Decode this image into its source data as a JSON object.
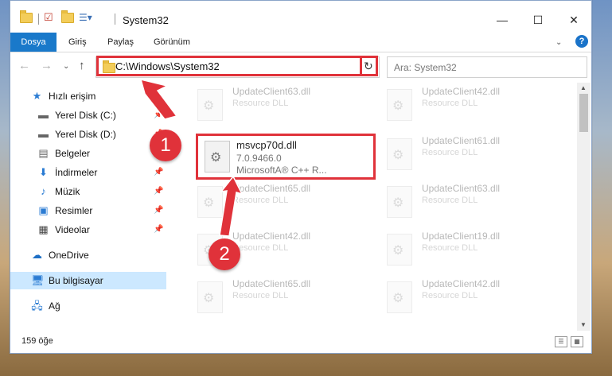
{
  "window": {
    "title": "System32",
    "minimize": "—",
    "maximize": "☐",
    "close": "✕"
  },
  "ribbon": {
    "tabs": [
      "Dosya",
      "Giriş",
      "Paylaş",
      "Görünüm"
    ],
    "help": "?"
  },
  "address": {
    "path": "C:\\Windows\\System32",
    "search_placeholder": "Ara: System32"
  },
  "sidebar": {
    "items": [
      {
        "label": "Hızlı erişim",
        "icon": "star-icon"
      },
      {
        "label": "Yerel Disk (C:)",
        "icon": "drive-icon"
      },
      {
        "label": "Yerel Disk (D:)",
        "icon": "drive-icon"
      },
      {
        "label": "Belgeler",
        "icon": "documents-icon"
      },
      {
        "label": "İndirmeler",
        "icon": "download-icon"
      },
      {
        "label": "Müzik",
        "icon": "music-icon"
      },
      {
        "label": "Resimler",
        "icon": "pictures-icon"
      },
      {
        "label": "Videolar",
        "icon": "video-icon"
      },
      {
        "label": "OneDrive",
        "icon": "cloud-icon"
      },
      {
        "label": "Bu bilgisayar",
        "icon": "computer-icon"
      },
      {
        "label": "Ağ",
        "icon": "network-icon"
      }
    ]
  },
  "files": {
    "col1": [
      {
        "name": "UpdateClient63.dll",
        "desc": "Resource DLL"
      },
      {
        "name": "UpdateClient65.dll",
        "desc": "Resource DLL"
      },
      {
        "name": "UpdateClient42.dll",
        "desc": "Resource DLL"
      },
      {
        "name": "UpdateClient65.dll",
        "desc": "Resource DLL"
      }
    ],
    "col2": [
      {
        "name": "UpdateClient42.dll",
        "desc": "Resource DLL"
      },
      {
        "name": "UpdateClient61.dll",
        "desc": "Resource DLL"
      },
      {
        "name": "UpdateClient63.dll",
        "desc": "Resource DLL"
      },
      {
        "name": "UpdateClient19.dll",
        "desc": "Resource DLL"
      },
      {
        "name": "UpdateClient42.dll",
        "desc": "Resource DLL"
      }
    ],
    "selected": {
      "name": "msvcp70d.dll",
      "version": "7.0.9466.0",
      "company": "MicrosoftA® C++ R..."
    }
  },
  "status": {
    "count": "159 öğe"
  },
  "annotations": {
    "step1": "1",
    "step2": "2",
    "color": "#e0323a"
  }
}
